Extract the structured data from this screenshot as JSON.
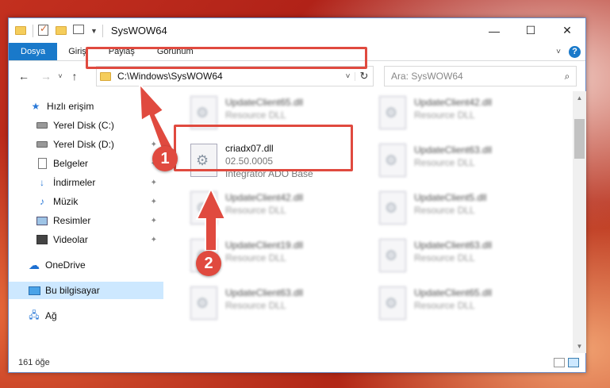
{
  "window": {
    "title": "SysWOW64",
    "controls": {
      "minimize": "—",
      "maximize": "☐",
      "close": "✕"
    }
  },
  "ribbon": {
    "tabs": [
      "Dosya",
      "Giriş",
      "Paylaş",
      "Görünüm"
    ],
    "help": "?"
  },
  "nav": {
    "address_path": "C:\\Windows\\SysWOW64",
    "search_placeholder": "Ara: SysWOW64"
  },
  "sidebar": {
    "items": [
      {
        "label": "Hızlı erişim",
        "icon": "star-icon"
      },
      {
        "label": "Yerel Disk (C:)",
        "icon": "disk-icon",
        "pinned": true
      },
      {
        "label": "Yerel Disk (D:)",
        "icon": "disk-icon",
        "pinned": true
      },
      {
        "label": "Belgeler",
        "icon": "document-icon",
        "pinned": true
      },
      {
        "label": "İndirmeler",
        "icon": "download-icon",
        "pinned": true
      },
      {
        "label": "Müzik",
        "icon": "music-icon",
        "pinned": true
      },
      {
        "label": "Resimler",
        "icon": "image-icon",
        "pinned": true
      },
      {
        "label": "Videolar",
        "icon": "video-icon",
        "pinned": true
      },
      {
        "label": "OneDrive",
        "icon": "cloud-icon"
      },
      {
        "label": "Bu bilgisayar",
        "icon": "computer-icon",
        "selected": true
      },
      {
        "label": "Ağ",
        "icon": "network-icon"
      }
    ]
  },
  "files": {
    "left": [
      {
        "name": "UpdateClient65.dll",
        "sub1": "Resource DLL"
      },
      {
        "name": "criadx07.dll",
        "sub1": "02.50.0005",
        "sub2": "Integrator ADO Base",
        "highlighted": true
      },
      {
        "name": "UpdateClient42.dll",
        "sub1": "Resource DLL"
      },
      {
        "name": "UpdateClient19.dll",
        "sub1": "Resource DLL"
      },
      {
        "name": "UpdateClient63.dll",
        "sub1": "Resource DLL"
      }
    ],
    "right": [
      {
        "name": "UpdateClient42.dll",
        "sub1": "Resource DLL"
      },
      {
        "name": "UpdateClient63.dll",
        "sub1": "Resource DLL"
      },
      {
        "name": "UpdateClient5.dll",
        "sub1": "Resource DLL"
      },
      {
        "name": "UpdateClient63.dll",
        "sub1": "Resource DLL"
      },
      {
        "name": "UpdateClient65.dll",
        "sub1": "Resource DLL"
      }
    ]
  },
  "status": {
    "count": "161 öğe"
  },
  "annotations": {
    "step1": "1",
    "step2": "2"
  },
  "colors": {
    "accent": "#1979ca",
    "highlight": "#e04a3f",
    "selected_bg": "#cde8ff"
  }
}
